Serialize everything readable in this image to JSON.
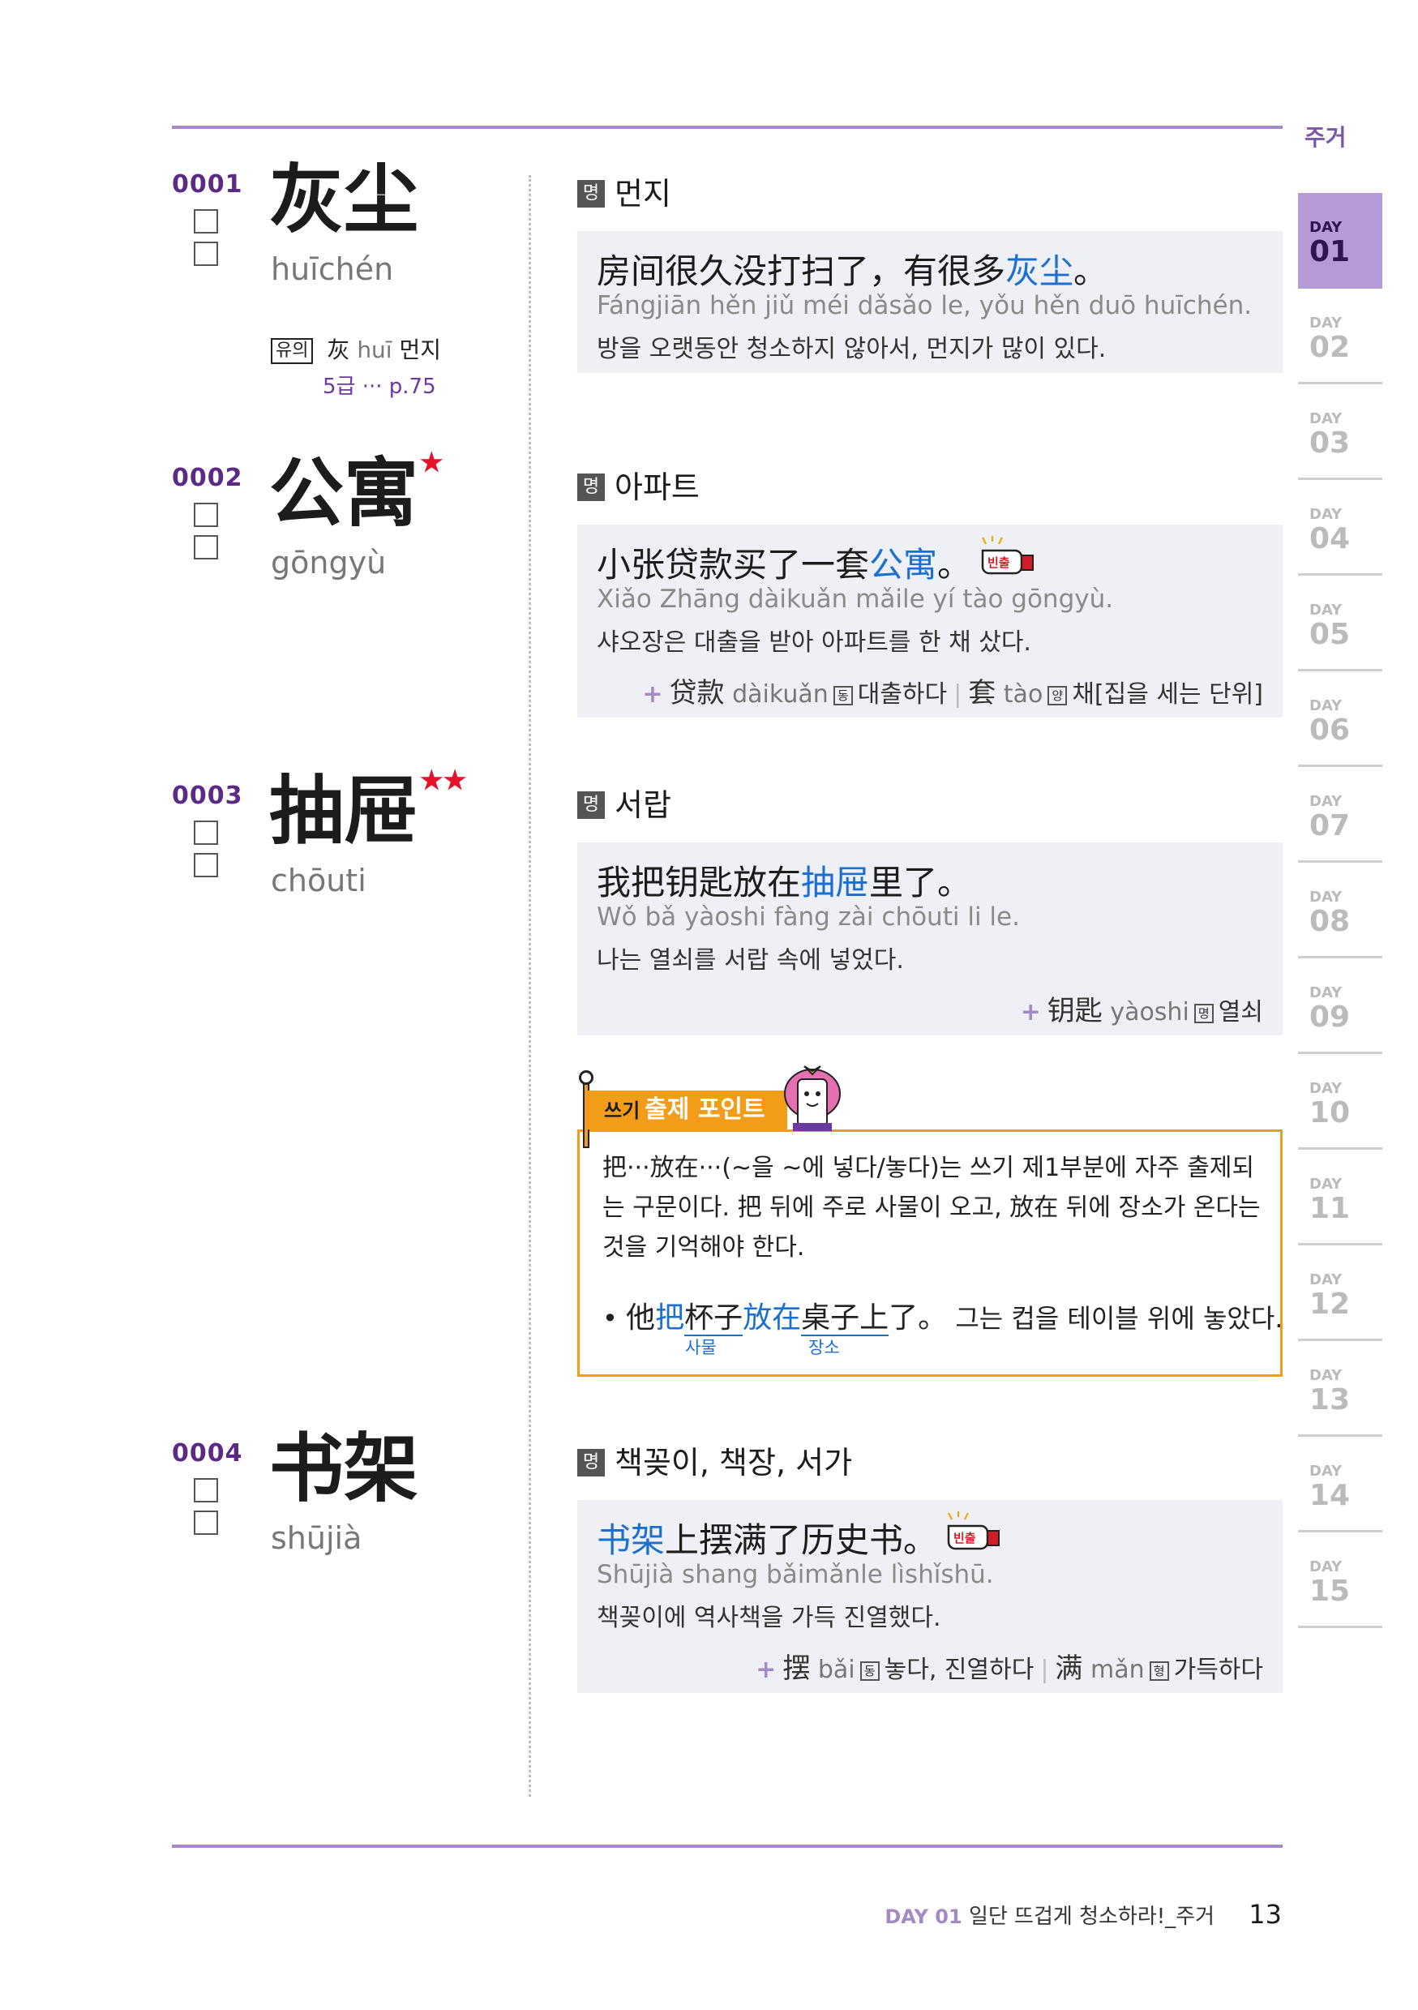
{
  "entries": [
    {
      "num": "0001",
      "word": "灰尘",
      "stars": "",
      "pinyin": "huīchén",
      "synonym": {
        "badge": "유의",
        "word": "灰",
        "pinyin": "huī",
        "meaning": "먼지",
        "ref": "5급 ··· p.75"
      },
      "pos": "명",
      "meaning": "먼지",
      "example": {
        "pre": "房间很久没打扫了，有很多",
        "hl": "灰尘",
        "post": "。",
        "pinyin": "Fángjiān hěn jiǔ méi dǎsǎo le, yǒu hěn duō huīchén.",
        "ko": "방을 오랫동안 청소하지 않아서, 먼지가 많이 있다."
      }
    },
    {
      "num": "0002",
      "word": "公寓",
      "stars": "★",
      "pinyin": "gōngyù",
      "pos": "명",
      "meaning": "아파트",
      "example": {
        "pre": "小张贷款买了一套",
        "hl": "公寓",
        "post": "。",
        "pinyin": "Xiǎo Zhāng dàikuǎn mǎile yí tào gōngyù.",
        "ko": "샤오장은 대출을 받아 아파트를 한 채 샀다."
      },
      "plus": [
        {
          "zh": "贷款",
          "py": "dàikuǎn",
          "pos": "동",
          "ko": "대출하다"
        },
        {
          "zh": "套",
          "py": "tào",
          "pos": "양",
          "ko": "채[집을 세는 단위]"
        }
      ]
    },
    {
      "num": "0003",
      "word": "抽屉",
      "stars": "★★",
      "pinyin": "chōuti",
      "pos": "명",
      "meaning": "서랍",
      "example": {
        "pre": "我把钥匙放在",
        "hl": "抽屉",
        "post": "里了。",
        "pinyin": "Wǒ bǎ yàoshi fàng zài chōuti li le.",
        "ko": "나는 열쇠를 서랍 속에 넣었다."
      },
      "plus": [
        {
          "zh": "钥匙",
          "py": "yàoshi",
          "pos": "명",
          "ko": "열쇠"
        }
      ]
    },
    {
      "num": "0004",
      "word": "书架",
      "stars": "",
      "pinyin": "shūjià",
      "pos": "명",
      "meaning": "책꽂이, 책장, 서가",
      "example": {
        "pre": "",
        "hl": "书架",
        "post": "上摆满了历史书。",
        "pinyin": "Shūjià shang bǎimǎnle lìshǐshū.",
        "ko": "책꽂이에 역사책을 가득 진열했다."
      },
      "plus": [
        {
          "zh": "摆",
          "py": "bǎi",
          "pos": "동",
          "ko": "놓다, 진열하다"
        },
        {
          "zh": "满",
          "py": "mǎn",
          "pos": "형",
          "ko": "가득하다"
        }
      ]
    }
  ],
  "freq_label": "빈출",
  "point": {
    "title_small": "쓰기",
    "title": "출제 포인트",
    "text": "把···放在···(~을 ~에 넣다/놓다)는 쓰기 제1부분에 자주 출제되는 구문이다. 把 뒤에 주로 사물이 오고, 放在 뒤에 장소가 온다는 것을 기억해야 한다.",
    "example": {
      "p1": "他",
      "p2": "把",
      "p3": "杯子",
      "p4": "放在",
      "p5": "桌子上",
      "p6": "了。",
      "ko": "그는 컵을 테이블 위에 놓았다.",
      "tag1": "사물",
      "tag2": "장소"
    }
  },
  "sidebar": {
    "title": "주거",
    "day_label": "DAY",
    "days": [
      "01",
      "02",
      "03",
      "04",
      "05",
      "06",
      "07",
      "08",
      "09",
      "10",
      "11",
      "12",
      "13",
      "14",
      "15"
    ],
    "active": "01"
  },
  "footer": {
    "day": "DAY 01",
    "title": "일단 뜨겁게 청소하라!_주거",
    "page": "13"
  },
  "colors": {
    "accent": "#a48ac4",
    "highlight": "#1a6fd0",
    "point": "#f39c1a",
    "star": "#e5132b"
  }
}
